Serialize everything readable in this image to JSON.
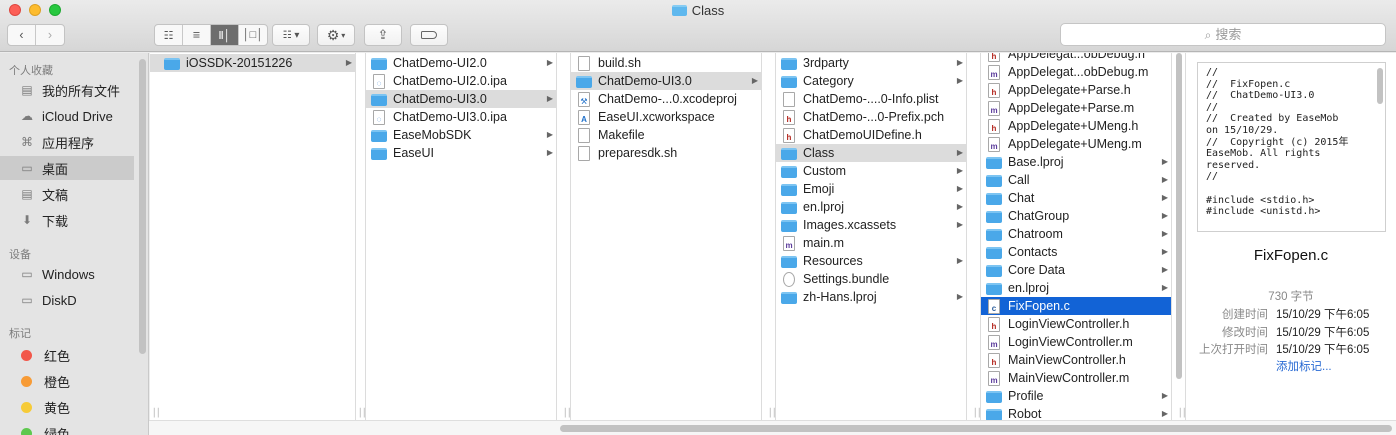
{
  "window": {
    "title": "Class"
  },
  "toolbar": {
    "search_placeholder": "搜索"
  },
  "sidebar": {
    "favorites_header": "个人收藏",
    "favorites": [
      {
        "label": "我的所有文件",
        "icon": "all-files-icon"
      },
      {
        "label": "iCloud Drive",
        "icon": "cloud-icon"
      },
      {
        "label": "应用程序",
        "icon": "applications-icon"
      },
      {
        "label": "桌面",
        "icon": "desktop-icon",
        "selected": true
      },
      {
        "label": "文稿",
        "icon": "documents-icon"
      },
      {
        "label": "下载",
        "icon": "downloads-icon"
      }
    ],
    "devices_header": "设备",
    "devices": [
      {
        "label": "Windows",
        "icon": "disk-icon"
      },
      {
        "label": "DiskD",
        "icon": "disk-icon"
      }
    ],
    "tags_header": "标记",
    "tags": [
      {
        "label": "红色",
        "color": "#f2574a"
      },
      {
        "label": "橙色",
        "color": "#f79b36"
      },
      {
        "label": "黄色",
        "color": "#f6cb38"
      },
      {
        "label": "绿色",
        "color": "#5ec84e"
      }
    ]
  },
  "columns": [
    {
      "items": [
        {
          "name": "iOSSDK-20151226",
          "type": "folder",
          "arrow": true,
          "state": "gray"
        }
      ]
    },
    {
      "items": [
        {
          "name": "ChatDemo-UI2.0",
          "type": "folder",
          "arrow": true
        },
        {
          "name": "ChatDemo-UI2.0.ipa",
          "type": "ipa"
        },
        {
          "name": "ChatDemo-UI3.0",
          "type": "folder",
          "arrow": true,
          "state": "gray"
        },
        {
          "name": "ChatDemo-UI3.0.ipa",
          "type": "ipa"
        },
        {
          "name": "EaseMobSDK",
          "type": "folder",
          "arrow": true
        },
        {
          "name": "EaseUI",
          "type": "folder",
          "arrow": true
        }
      ]
    },
    {
      "items": [
        {
          "name": "build.sh",
          "type": "doc"
        },
        {
          "name": "ChatDemo-UI3.0",
          "type": "folder",
          "arrow": true,
          "state": "gray"
        },
        {
          "name": "ChatDemo-...0.xcodeproj",
          "type": "xcodeproj"
        },
        {
          "name": "EaseUI.xcworkspace",
          "type": "workspace"
        },
        {
          "name": "Makefile",
          "type": "doc"
        },
        {
          "name": "preparesdk.sh",
          "type": "doc"
        }
      ]
    },
    {
      "items": [
        {
          "name": "3rdparty",
          "type": "folder",
          "arrow": true
        },
        {
          "name": "Category",
          "type": "folder",
          "arrow": true
        },
        {
          "name": "ChatDemo-....0-Info.plist",
          "type": "doc"
        },
        {
          "name": "ChatDemo-...0-Prefix.pch",
          "type": "h"
        },
        {
          "name": "ChatDemoUIDefine.h",
          "type": "h"
        },
        {
          "name": "Class",
          "type": "folder",
          "arrow": true,
          "state": "gray"
        },
        {
          "name": "Custom",
          "type": "folder",
          "arrow": true
        },
        {
          "name": "Emoji",
          "type": "folder",
          "arrow": true
        },
        {
          "name": "en.lproj",
          "type": "folder",
          "arrow": true
        },
        {
          "name": "Images.xcassets",
          "type": "folder",
          "arrow": true
        },
        {
          "name": "main.m",
          "type": "m"
        },
        {
          "name": "Resources",
          "type": "folder",
          "arrow": true
        },
        {
          "name": "Settings.bundle",
          "type": "bundle"
        },
        {
          "name": "zh-Hans.lproj",
          "type": "folder",
          "arrow": true
        }
      ]
    },
    {
      "items": [
        {
          "name": "AppDelegat...obDebug.h",
          "type": "h"
        },
        {
          "name": "AppDelegat...obDebug.m",
          "type": "m"
        },
        {
          "name": "AppDelegate+Parse.h",
          "type": "h"
        },
        {
          "name": "AppDelegate+Parse.m",
          "type": "m"
        },
        {
          "name": "AppDelegate+UMeng.h",
          "type": "h"
        },
        {
          "name": "AppDelegate+UMeng.m",
          "type": "m"
        },
        {
          "name": "Base.lproj",
          "type": "folder",
          "arrow": true
        },
        {
          "name": "Call",
          "type": "folder",
          "arrow": true
        },
        {
          "name": "Chat",
          "type": "folder",
          "arrow": true
        },
        {
          "name": "ChatGroup",
          "type": "folder",
          "arrow": true
        },
        {
          "name": "Chatroom",
          "type": "folder",
          "arrow": true
        },
        {
          "name": "Contacts",
          "type": "folder",
          "arrow": true
        },
        {
          "name": "Core Data",
          "type": "folder",
          "arrow": true
        },
        {
          "name": "en.lproj",
          "type": "folder",
          "arrow": true
        },
        {
          "name": "FixFopen.c",
          "type": "c",
          "state": "blue"
        },
        {
          "name": "LoginViewController.h",
          "type": "h"
        },
        {
          "name": "LoginViewController.m",
          "type": "m"
        },
        {
          "name": "MainViewController.h",
          "type": "h"
        },
        {
          "name": "MainViewController.m",
          "type": "m"
        },
        {
          "name": "Profile",
          "type": "folder",
          "arrow": true
        },
        {
          "name": "Robot",
          "type": "folder",
          "arrow": true
        }
      ]
    }
  ],
  "preview": {
    "code": "//\n//  FixFopen.c\n//  ChatDemo-UI3.0\n//\n//  Created by EaseMob\non 15/10/29.\n//  Copyright (c) 2015年\nEaseMob. All rights\nreserved.\n//\n\n#include <stdio.h>\n#include <unistd.h>",
    "file_name": "FixFopen.c",
    "size": "730 字节",
    "created_label": "创建时间",
    "created_value": "15/10/29 下午6:05",
    "modified_label": "修改时间",
    "modified_value": "15/10/29 下午6:05",
    "opened_label": "上次打开时间",
    "opened_value": "15/10/29 下午6:05",
    "add_tags": "添加标记..."
  }
}
